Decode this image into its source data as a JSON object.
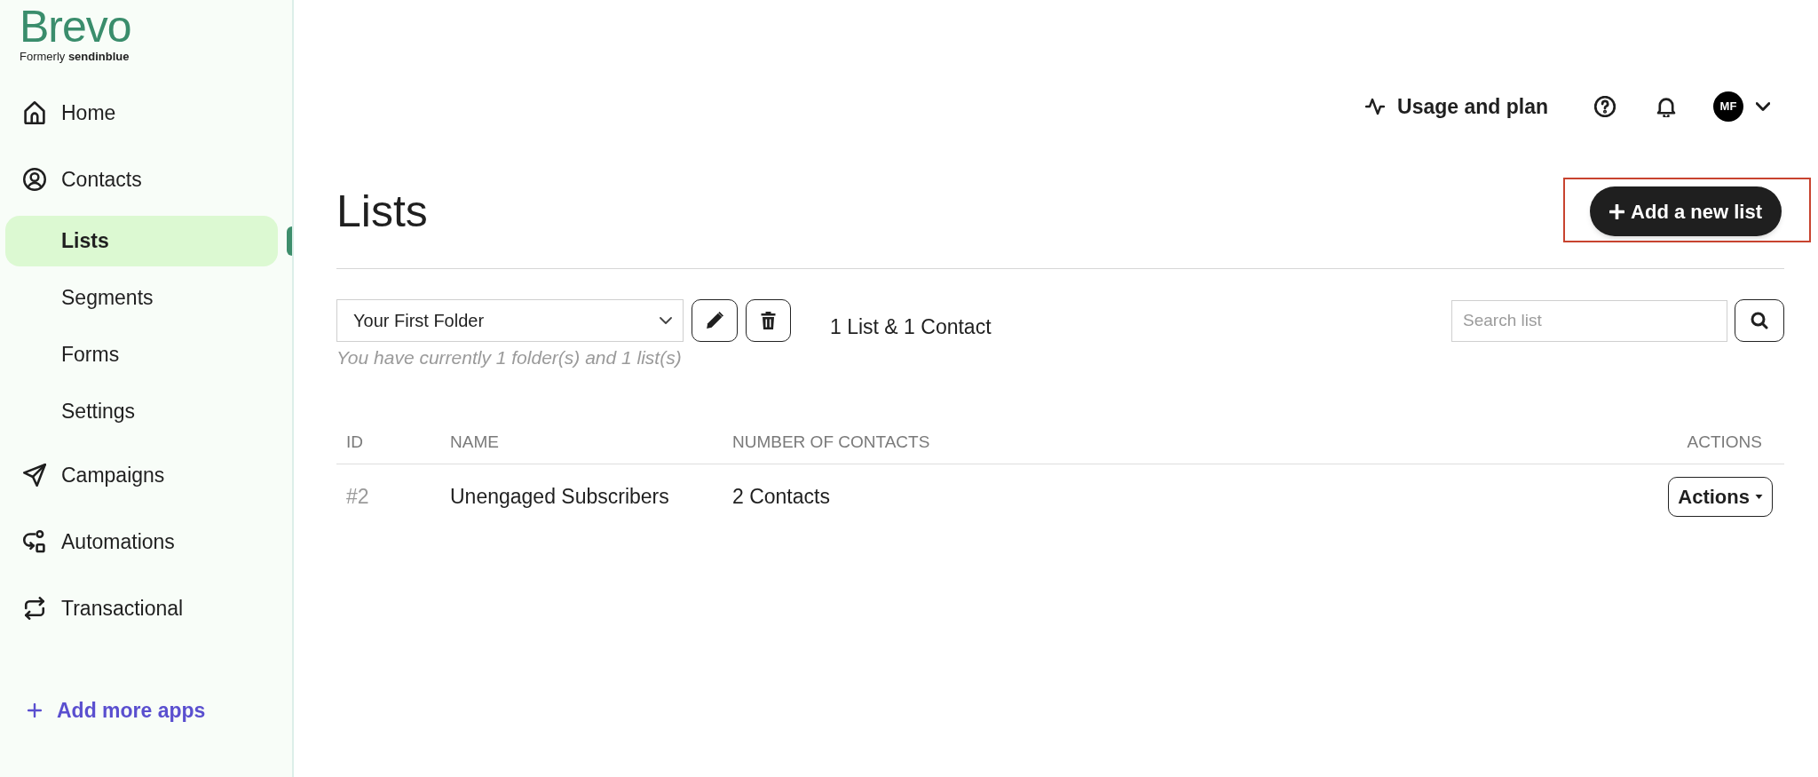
{
  "sidebar": {
    "logo": {
      "wordmark": "Brevo",
      "tagline": "Formerly **sendinblue**"
    },
    "items": [
      {
        "label": "Home",
        "selected": false
      },
      {
        "label": "Contacts",
        "selected": false,
        "children": [
          {
            "label": "Lists",
            "selected": true
          },
          {
            "label": "Segments",
            "selected": false
          },
          {
            "label": "Forms",
            "selected": false
          },
          {
            "label": "Settings",
            "selected": false
          }
        ]
      },
      {
        "label": "Campaigns",
        "selected": false
      },
      {
        "label": "Automations",
        "selected": false
      },
      {
        "label": "Transactional",
        "selected": false
      }
    ],
    "add_apps": {
      "label": "Add more apps"
    }
  },
  "header": {
    "usage": "Usage and plan",
    "avatar": "MF"
  },
  "page": {
    "title": "Lists",
    "add_button": {
      "label": "Add a new list",
      "highlighted": true
    }
  },
  "toolbar": {
    "folder": {
      "value": "Your First Folder"
    },
    "summary": "1 List & 1 Contact",
    "hint": "You have currently 1 folder(s) and 1 list(s)",
    "search": {
      "placeholder": "Search list"
    }
  },
  "table": {
    "columns": [
      "ID",
      "NAME",
      "NUMBER OF CONTACTS",
      "ACTIONS"
    ],
    "rows": [
      {
        "id": "#2",
        "name": "Unengaged Subscribers",
        "contacts": "2 Contacts",
        "action": "Actions"
      }
    ]
  }
}
